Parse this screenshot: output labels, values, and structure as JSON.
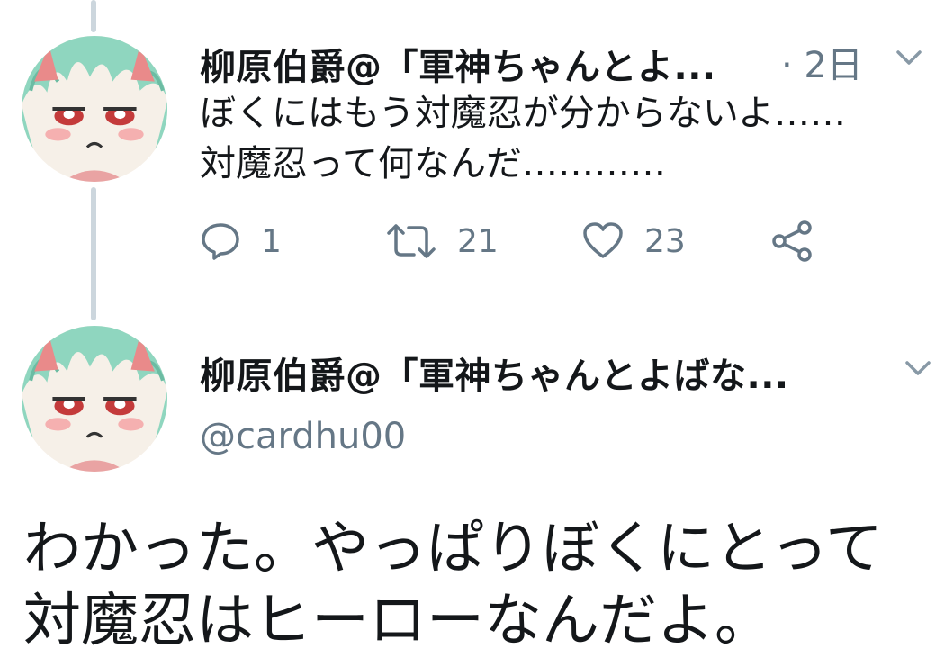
{
  "tweet1": {
    "display_name": "柳原伯爵@「軍神ちゃんとよ...",
    "time": "· 2日",
    "text_line1": "ぼくにはもう対魔忍が分からないよ……",
    "text_line2": "対魔忍って何なんだ…………",
    "actions": {
      "reply_count": "1",
      "retweet_count": "21",
      "like_count": "23"
    }
  },
  "tweet2": {
    "display_name": "柳原伯爵@「軍神ちゃんとよばな...",
    "handle": "@cardhu00",
    "text_line1": "わかった。やっぱりぼくにとって",
    "text_line2": "対魔忍はヒーローなんだよ。"
  },
  "colors": {
    "secondary_text": "#657786",
    "thread_line": "#ccd6dd",
    "avatar_hair": "#8fd6bf"
  },
  "icons": [
    "reply-icon",
    "retweet-icon",
    "like-icon",
    "share-icon",
    "chevron-down-icon"
  ]
}
